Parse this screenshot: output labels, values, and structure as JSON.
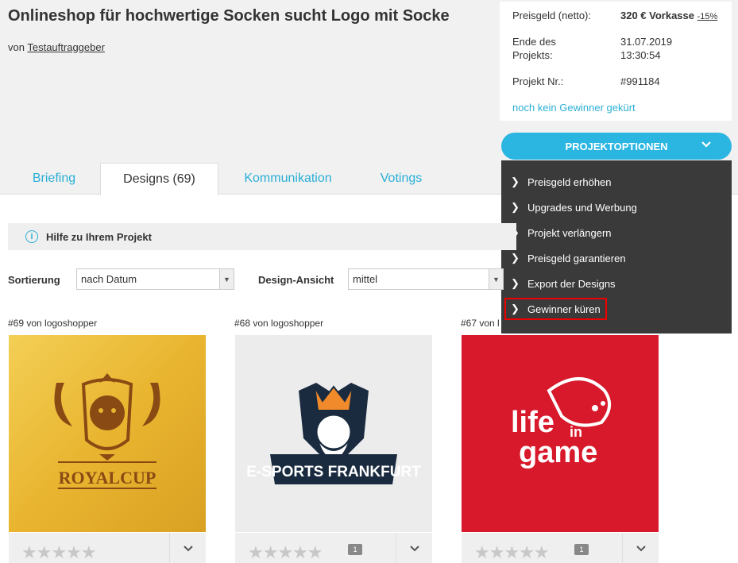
{
  "header": {
    "title": "Onlineshop für hochwertige Socken sucht Logo mit Socke",
    "by_prefix": "von",
    "client": "Testauftraggeber"
  },
  "info": {
    "prize_label": "Preisgeld (netto):",
    "prize_value": "320 € Vorkasse",
    "prize_discount": "-15%",
    "end_label_1": "Ende des",
    "end_label_2": "Projekts:",
    "end_date": "31.07.2019",
    "end_time": "13:30:54",
    "project_label": "Projekt Nr.:",
    "project_value": "#991184",
    "no_winner": "noch kein Gewinner gekürt"
  },
  "project_options": {
    "label": "PROJEKTOPTIONEN",
    "items": [
      "Preisgeld erhöhen",
      "Upgrades und Werbung",
      "Projekt verlängern",
      "Preisgeld garantieren",
      "Export der Designs",
      "Gewinner küren"
    ]
  },
  "tabs": [
    "Briefing",
    "Designs (69)",
    "Kommunikation",
    "Votings"
  ],
  "help": {
    "label": "Hilfe zu Ihrem Projekt"
  },
  "filters": {
    "sort_label": "Sortierung",
    "sort_value": "nach Datum",
    "view_label": "Design-Ansicht",
    "view_value": "mittel"
  },
  "designs": [
    {
      "caption": "#69 von logoshopper",
      "logo_text": "ROYALCUP",
      "comments": ""
    },
    {
      "caption": "#68 von logoshopper",
      "logo_text": "E-SPORTS FRANKFURT",
      "comments": "1"
    },
    {
      "caption": "#67 von l",
      "logo_line1": "life",
      "logo_line2": "in",
      "logo_line3": "game",
      "comments": "1"
    }
  ],
  "colors": {
    "accent": "#2bb6e2",
    "dropdown_bg": "#3a3a3a",
    "highlight": "#e00000"
  }
}
